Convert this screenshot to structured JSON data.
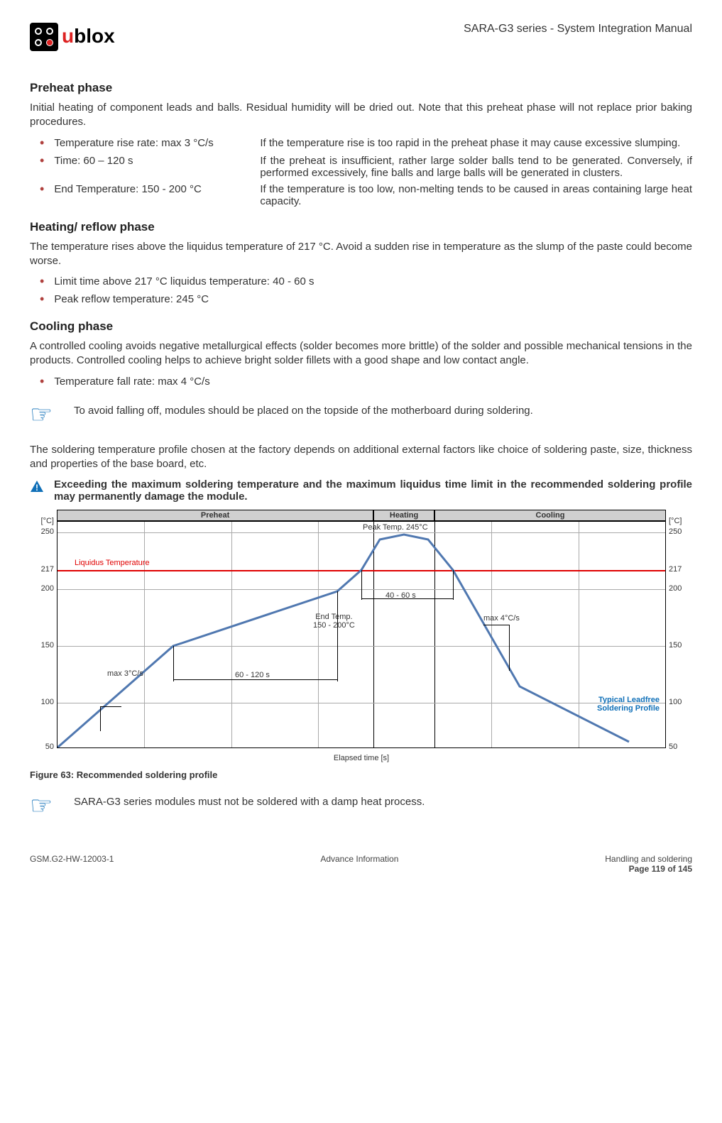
{
  "header": {
    "brand_prefix": "u",
    "brand_suffix": "blox",
    "doc_title": "SARA-G3 series - System Integration Manual"
  },
  "sections": {
    "preheat_title": "Preheat phase",
    "preheat_intro": "Initial heating of component leads and balls. Residual humidity will be dried out. Note that this preheat phase will not replace prior baking procedures.",
    "preheat_b1_left": "Temperature rise rate: max 3 °C/s",
    "preheat_b1_right": "If the temperature rise is too rapid in the preheat phase it may cause excessive slumping.",
    "preheat_b2_left": "Time: 60 – 120 s",
    "preheat_b2_right": "If the preheat is insufficient, rather large solder balls tend to be generated. Conversely, if performed excessively, fine balls and large balls will be generated in clusters.",
    "preheat_b3_left": "End Temperature: 150 - 200 °C",
    "preheat_b3_right": "If the temperature is too low, non-melting tends to be caused in areas containing large heat capacity.",
    "heating_title": "Heating/ reflow phase",
    "heating_intro": "The temperature rises above the liquidus temperature of 217 °C. Avoid a sudden rise in temperature as the slump of the paste could become worse.",
    "heating_b1": "Limit time above 217 °C liquidus temperature: 40 - 60 s",
    "heating_b2": "Peak reflow temperature: 245 °C",
    "cooling_title": "Cooling phase",
    "cooling_intro": "A controlled cooling avoids negative metallurgical effects (solder becomes more brittle) of the solder and possible mechanical tensions in the products. Controlled cooling helps to achieve bright solder fillets with a good shape and low contact angle.",
    "cooling_b1": "Temperature fall rate: max 4 °C/s",
    "note1": "To avoid falling off, modules should be placed on the topside of the motherboard during soldering.",
    "profile_para": "The soldering temperature profile chosen at the factory depends on additional external factors like choice of soldering paste, size, thickness and properties of the base board, etc.",
    "warn_text": "Exceeding the maximum soldering temperature and the maximum liquidus time limit in the recommended soldering profile may permanently damage the module.",
    "fig_caption": "Figure 63: Recommended soldering profile",
    "note2": "SARA-G3 series modules must not be soldered with a damp heat process."
  },
  "chart_data": {
    "type": "line",
    "title": "Recommended soldering profile",
    "xlabel": "Elapsed time [s]",
    "ylabel_left": "[°C]",
    "ylabel_right": "[°C]",
    "ylim": [
      50,
      250
    ],
    "y_ticks": [
      50,
      100,
      150,
      200,
      217,
      250
    ],
    "phases": [
      {
        "name": "Preheat",
        "width_fraction": 0.52
      },
      {
        "name": "Heating",
        "width_fraction": 0.1
      },
      {
        "name": "Cooling",
        "width_fraction": 0.38
      }
    ],
    "liquidus_label": "Liquidus Temperature",
    "liquidus_temp": 217,
    "annotations": {
      "peak_temp": "Peak Temp. 245°C",
      "heating_duration": "40 - 60 s",
      "end_temp": "End Temp.\n150 - 200°C",
      "preheat_duration": "60 - 120 s",
      "rise_rate": "max 3°C/s",
      "fall_rate": "max 4°C/s",
      "profile_label": "Typical Leadfree\nSoldering Profile"
    },
    "series": [
      {
        "name": "Typical Leadfree Soldering Profile",
        "points_x_fraction": [
          0.0,
          0.19,
          0.46,
          0.5,
          0.53,
          0.57,
          0.61,
          0.65,
          0.76,
          0.94
        ],
        "points_y_temp": [
          50,
          150,
          198,
          217,
          240,
          245,
          240,
          217,
          115,
          55
        ]
      }
    ]
  },
  "footer": {
    "left": "GSM.G2-HW-12003-1",
    "center": "Advance Information",
    "right_line1": "Handling and soldering",
    "right_line2": "Page 119 of 145"
  }
}
